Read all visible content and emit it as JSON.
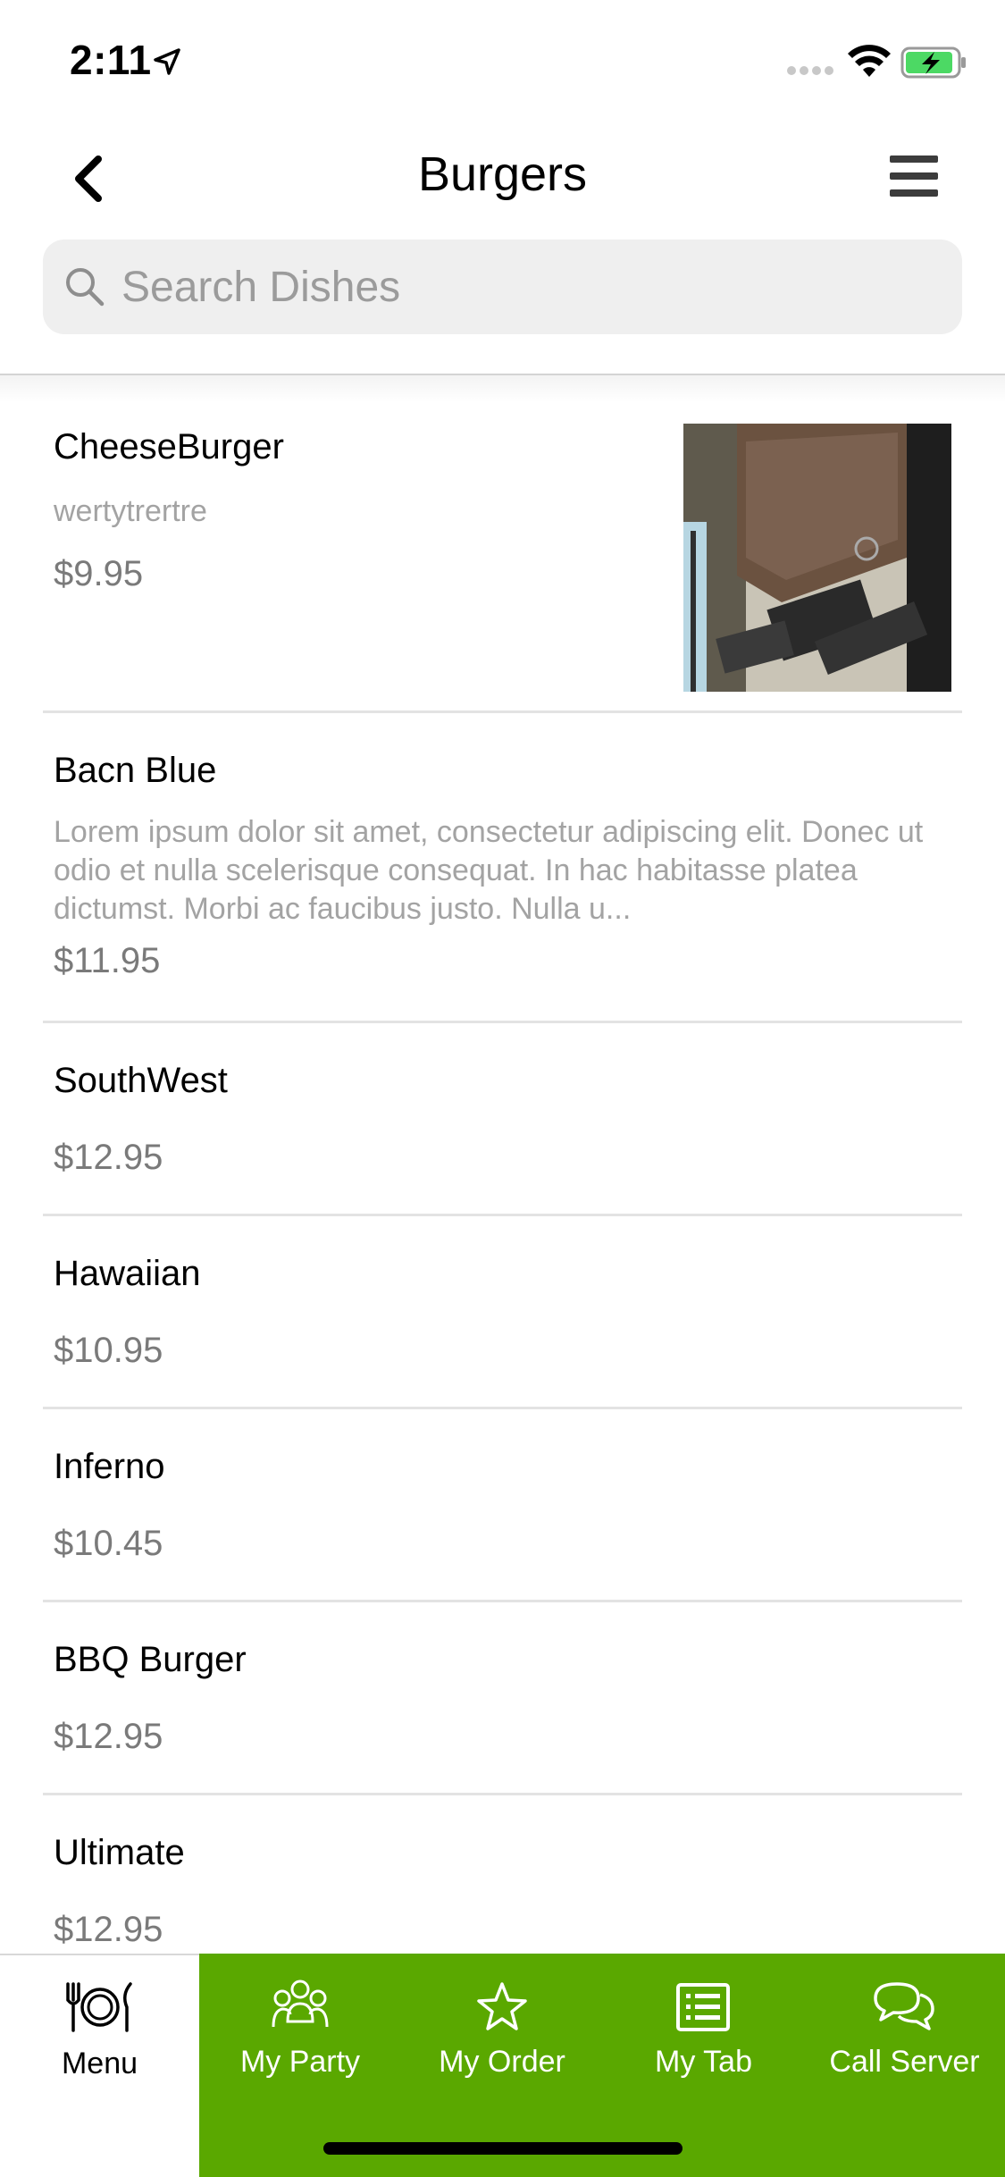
{
  "status_bar": {
    "time": "2:11"
  },
  "header": {
    "title": "Burgers"
  },
  "search": {
    "placeholder": "Search Dishes"
  },
  "dishes": [
    {
      "name": "CheeseBurger",
      "description": "wertytrertre",
      "price": "$9.95"
    },
    {
      "name": "Bacn Blue",
      "description": "Lorem ipsum dolor sit amet, consectetur adipiscing elit. Donec ut odio et nulla scelerisque consequat. In hac habitasse platea dictumst. Morbi ac faucibus justo. Nulla u...",
      "price": "$11.95"
    },
    {
      "name": "SouthWest",
      "description": "",
      "price": "$12.95"
    },
    {
      "name": "Hawaiian",
      "description": "",
      "price": "$10.95"
    },
    {
      "name": "Inferno",
      "description": "",
      "price": "$10.45"
    },
    {
      "name": "BBQ Burger",
      "description": "",
      "price": "$12.95"
    },
    {
      "name": "Ultimate",
      "description": "",
      "price": "$12.95"
    }
  ],
  "tabs": [
    {
      "label": "Menu",
      "icon": "plate-cutlery-icon",
      "active": true
    },
    {
      "label": "My Party",
      "icon": "group-icon",
      "active": false
    },
    {
      "label": "My Order",
      "icon": "star-icon",
      "active": false
    },
    {
      "label": "My Tab",
      "icon": "receipt-list-icon",
      "active": false
    },
    {
      "label": "Call Server",
      "icon": "chat-bubbles-icon",
      "active": false
    }
  ],
  "colors": {
    "tab_bar_green": "#5aa800",
    "battery_green": "#4cd964",
    "price_gray": "#7a7a7a",
    "description_gray": "#a3a3a3"
  }
}
